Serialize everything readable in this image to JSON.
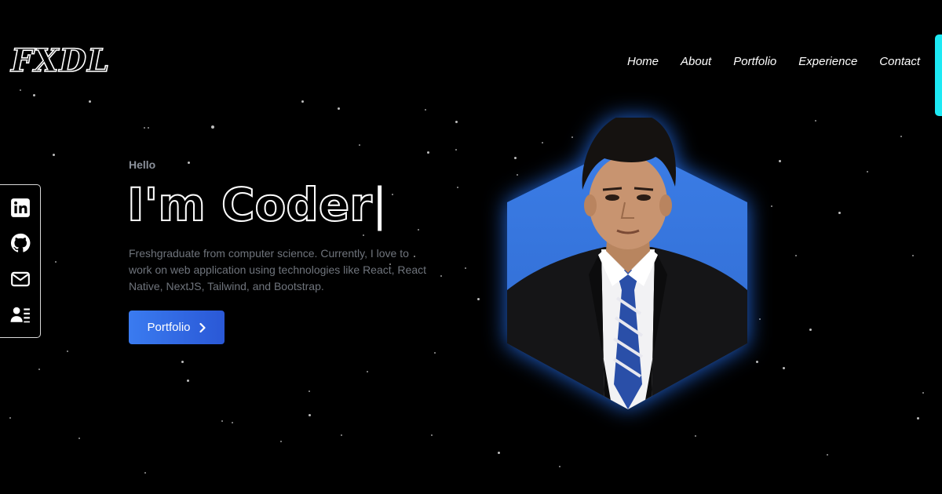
{
  "header": {
    "logo": "FXDL",
    "nav": [
      {
        "label": "Home"
      },
      {
        "label": "About"
      },
      {
        "label": "Portfolio"
      },
      {
        "label": "Experience"
      },
      {
        "label": "Contact"
      }
    ]
  },
  "social": {
    "items": [
      {
        "icon": "linkedin-icon"
      },
      {
        "icon": "github-icon"
      },
      {
        "icon": "mail-icon"
      },
      {
        "icon": "contact-card-icon"
      }
    ]
  },
  "hero": {
    "greeting": "Hello",
    "headline": "I'm Coder",
    "caret": "|",
    "description": "Freshgraduate from computer science. Currently, I love to work on web application using technologies like React, React Native, NextJS, Tailwind, and Bootstrap.",
    "button_label": "Portfolio",
    "button_icon": "chevron-right-icon"
  },
  "colors": {
    "background": "#000000",
    "accent": "#3a7bf0",
    "scrollbar": "#1de9f4",
    "hex_fill": "#3677e0"
  }
}
